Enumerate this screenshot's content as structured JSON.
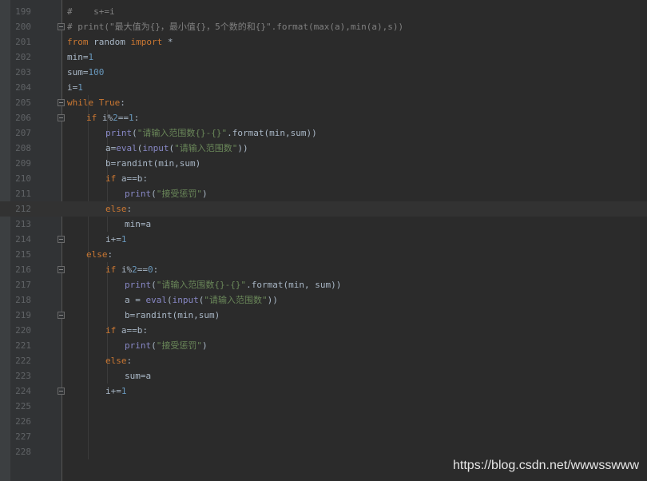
{
  "colors": {
    "background": "#2b2b2b",
    "gutter": "#313335",
    "line_number": "#606366",
    "keyword": "#cc7832",
    "string": "#6a8759",
    "number": "#6897bb",
    "builtin": "#8888c6",
    "comment": "#808080",
    "text": "#a9b7c6"
  },
  "current_line": 212,
  "lines": [
    {
      "n": "199",
      "fold": false,
      "indent": 0,
      "tokens": [
        {
          "t": "#    s+=i",
          "c": "comment"
        }
      ]
    },
    {
      "n": "200",
      "fold": true,
      "indent": 0,
      "tokens": [
        {
          "t": "# print(\"最大值为{}，最小值{}，5个数的和{}\".format(max(a),min(a),s))",
          "c": "comment"
        }
      ]
    },
    {
      "n": "201",
      "fold": false,
      "indent": 0,
      "tokens": [
        {
          "t": "from",
          "c": "keyword"
        },
        {
          "t": " random ",
          "c": "text"
        },
        {
          "t": "import",
          "c": "keyword"
        },
        {
          "t": " *",
          "c": "text"
        }
      ]
    },
    {
      "n": "202",
      "fold": false,
      "indent": 0,
      "tokens": [
        {
          "t": "min",
          "c": "text"
        },
        {
          "t": "=",
          "c": "text"
        },
        {
          "t": "1",
          "c": "number"
        }
      ]
    },
    {
      "n": "203",
      "fold": false,
      "indent": 0,
      "tokens": [
        {
          "t": "sum",
          "c": "text"
        },
        {
          "t": "=",
          "c": "text"
        },
        {
          "t": "100",
          "c": "number"
        }
      ]
    },
    {
      "n": "204",
      "fold": false,
      "indent": 0,
      "tokens": [
        {
          "t": "i",
          "c": "text"
        },
        {
          "t": "=",
          "c": "text"
        },
        {
          "t": "1",
          "c": "number"
        }
      ]
    },
    {
      "n": "205",
      "fold": true,
      "indent": 0,
      "tokens": [
        {
          "t": "while",
          "c": "keyword"
        },
        {
          "t": " ",
          "c": "text"
        },
        {
          "t": "True",
          "c": "keyword"
        },
        {
          "t": ":",
          "c": "text"
        }
      ]
    },
    {
      "n": "206",
      "fold": true,
      "indent": 1,
      "tokens": [
        {
          "t": "if",
          "c": "keyword"
        },
        {
          "t": " i%",
          "c": "text"
        },
        {
          "t": "2",
          "c": "number"
        },
        {
          "t": "==",
          "c": "text"
        },
        {
          "t": "1",
          "c": "number"
        },
        {
          "t": ":",
          "c": "text"
        }
      ]
    },
    {
      "n": "207",
      "fold": false,
      "indent": 2,
      "tokens": [
        {
          "t": "print",
          "c": "builtin"
        },
        {
          "t": "(",
          "c": "text"
        },
        {
          "t": "\"请输入范围数{}-{}\"",
          "c": "string"
        },
        {
          "t": ".format(min,sum))",
          "c": "text"
        }
      ]
    },
    {
      "n": "208",
      "fold": false,
      "indent": 2,
      "tokens": [
        {
          "t": "a",
          "c": "text"
        },
        {
          "t": "=",
          "c": "text"
        },
        {
          "t": "eval",
          "c": "builtin"
        },
        {
          "t": "(",
          "c": "text"
        },
        {
          "t": "input",
          "c": "builtin"
        },
        {
          "t": "(",
          "c": "text"
        },
        {
          "t": "\"请输入范围数\"",
          "c": "string"
        },
        {
          "t": "))",
          "c": "text"
        }
      ]
    },
    {
      "n": "209",
      "fold": false,
      "indent": 2,
      "tokens": [
        {
          "t": "b",
          "c": "text"
        },
        {
          "t": "=randint(min,sum)",
          "c": "text"
        }
      ]
    },
    {
      "n": "210",
      "fold": false,
      "indent": 2,
      "tokens": [
        {
          "t": "if",
          "c": "keyword"
        },
        {
          "t": " a==b:",
          "c": "text"
        }
      ]
    },
    {
      "n": "211",
      "fold": false,
      "indent": 3,
      "tokens": [
        {
          "t": "print",
          "c": "builtin"
        },
        {
          "t": "(",
          "c": "text"
        },
        {
          "t": "\"接受惩罚\"",
          "c": "string"
        },
        {
          "t": ")",
          "c": "text"
        }
      ]
    },
    {
      "n": "212",
      "fold": false,
      "indent": 2,
      "tokens": [
        {
          "t": "else",
          "c": "keyword"
        },
        {
          "t": ":",
          "c": "text"
        }
      ]
    },
    {
      "n": "213",
      "fold": false,
      "indent": 3,
      "tokens": [
        {
          "t": "min",
          "c": "text"
        },
        {
          "t": "=a",
          "c": "text"
        }
      ]
    },
    {
      "n": "214",
      "fold": true,
      "indent": 2,
      "tokens": [
        {
          "t": "i",
          "c": "text"
        },
        {
          "t": "+=",
          "c": "text"
        },
        {
          "t": "1",
          "c": "number"
        }
      ]
    },
    {
      "n": "215",
      "fold": false,
      "indent": 1,
      "tokens": [
        {
          "t": "else",
          "c": "keyword"
        },
        {
          "t": ":",
          "c": "text"
        }
      ]
    },
    {
      "n": "216",
      "fold": true,
      "indent": 2,
      "tokens": [
        {
          "t": "if",
          "c": "keyword"
        },
        {
          "t": " i%",
          "c": "text"
        },
        {
          "t": "2",
          "c": "number"
        },
        {
          "t": "==",
          "c": "text"
        },
        {
          "t": "0",
          "c": "number"
        },
        {
          "t": ":",
          "c": "text"
        }
      ]
    },
    {
      "n": "217",
      "fold": false,
      "indent": 3,
      "tokens": [
        {
          "t": "print",
          "c": "builtin"
        },
        {
          "t": "(",
          "c": "text"
        },
        {
          "t": "\"请输入范围数{}-{}\"",
          "c": "string"
        },
        {
          "t": ".format(min, sum))",
          "c": "text"
        }
      ]
    },
    {
      "n": "218",
      "fold": false,
      "indent": 3,
      "tokens": [
        {
          "t": "a = ",
          "c": "text"
        },
        {
          "t": "eval",
          "c": "builtin"
        },
        {
          "t": "(",
          "c": "text"
        },
        {
          "t": "input",
          "c": "builtin"
        },
        {
          "t": "(",
          "c": "text"
        },
        {
          "t": "\"请输入范围数\"",
          "c": "string"
        },
        {
          "t": "))",
          "c": "text"
        }
      ]
    },
    {
      "n": "219",
      "fold": true,
      "indent": 3,
      "tokens": [
        {
          "t": "b",
          "c": "text"
        },
        {
          "t": "=randint(min,sum)",
          "c": "text"
        }
      ]
    },
    {
      "n": "220",
      "fold": false,
      "indent": 2,
      "tokens": [
        {
          "t": "if",
          "c": "keyword"
        },
        {
          "t": " a==b:",
          "c": "text"
        }
      ]
    },
    {
      "n": "221",
      "fold": false,
      "indent": 3,
      "tokens": [
        {
          "t": "print",
          "c": "builtin"
        },
        {
          "t": "(",
          "c": "text"
        },
        {
          "t": "\"接受惩罚\"",
          "c": "string"
        },
        {
          "t": ")",
          "c": "text"
        }
      ]
    },
    {
      "n": "222",
      "fold": false,
      "indent": 2,
      "tokens": [
        {
          "t": "else",
          "c": "keyword"
        },
        {
          "t": ":",
          "c": "text"
        }
      ]
    },
    {
      "n": "223",
      "fold": false,
      "indent": 3,
      "tokens": [
        {
          "t": "sum",
          "c": "text"
        },
        {
          "t": "=a",
          "c": "text"
        }
      ]
    },
    {
      "n": "224",
      "fold": true,
      "indent": 2,
      "tokens": [
        {
          "t": "i",
          "c": "text"
        },
        {
          "t": "+=",
          "c": "text"
        },
        {
          "t": "1",
          "c": "number"
        }
      ]
    },
    {
      "n": "225",
      "fold": false,
      "indent": 0,
      "tokens": []
    },
    {
      "n": "226",
      "fold": false,
      "indent": 0,
      "tokens": []
    },
    {
      "n": "227",
      "fold": false,
      "indent": 0,
      "tokens": []
    },
    {
      "n": "228",
      "fold": false,
      "indent": 0,
      "tokens": []
    }
  ],
  "watermark": "https://blog.csdn.net/wwwsswww"
}
